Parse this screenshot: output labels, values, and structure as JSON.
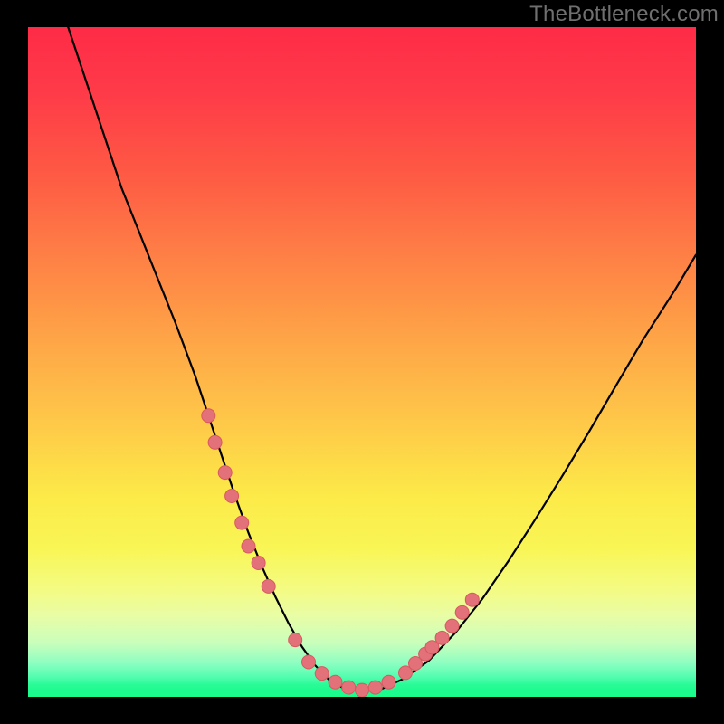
{
  "watermark": "TheBottleneck.com",
  "colors": {
    "background": "#000000",
    "curve": "#000000",
    "marker_fill": "#e37179",
    "marker_stroke": "#da5860",
    "gradient_top": "#fe2b47",
    "gradient_mid": "#fcea48",
    "gradient_bottom": "#19fc8b"
  },
  "chart_data": {
    "type": "line",
    "title": "",
    "xlabel": "",
    "ylabel": "",
    "xlim": [
      0,
      100
    ],
    "ylim": [
      0,
      100
    ],
    "note": "Axes and units are not shown in the image. x and y here are read in percent of the plot area (x left→right, y where 0=bottom 100=top).",
    "series": [
      {
        "name": "bottleneck-curve",
        "x": [
          6,
          10,
          14,
          18,
          22,
          25,
          27,
          29,
          31,
          33,
          35,
          37,
          39,
          41,
          43,
          45,
          47,
          50,
          53,
          56,
          60,
          64,
          68,
          72,
          76,
          80,
          84,
          88,
          92,
          97,
          100
        ],
        "y": [
          100,
          88,
          76,
          66,
          56,
          48,
          42,
          36,
          30,
          24.5,
          19.5,
          15,
          11,
          7.5,
          4.7,
          2.6,
          1.4,
          0.8,
          1.2,
          2.6,
          5.4,
          9.6,
          14.6,
          20.4,
          26.6,
          33.0,
          39.6,
          46.4,
          53.2,
          61.0,
          66.0
        ]
      }
    ],
    "markers": {
      "name": "highlight-points",
      "comment": "Pink dots clustered near the curve's lower flanks and trough.",
      "x": [
        27,
        28,
        29.5,
        30.5,
        32,
        33,
        34.5,
        36,
        40,
        42,
        44,
        46,
        48,
        50,
        52,
        54,
        56.5,
        58,
        59.5,
        60.5,
        62,
        63.5,
        65,
        66.5
      ],
      "y": [
        42,
        38,
        33.5,
        30,
        26,
        22.5,
        20,
        16.5,
        8.5,
        5.2,
        3.5,
        2.2,
        1.4,
        1.0,
        1.4,
        2.2,
        3.6,
        5.0,
        6.4,
        7.4,
        8.8,
        10.6,
        12.6,
        14.5
      ]
    }
  }
}
